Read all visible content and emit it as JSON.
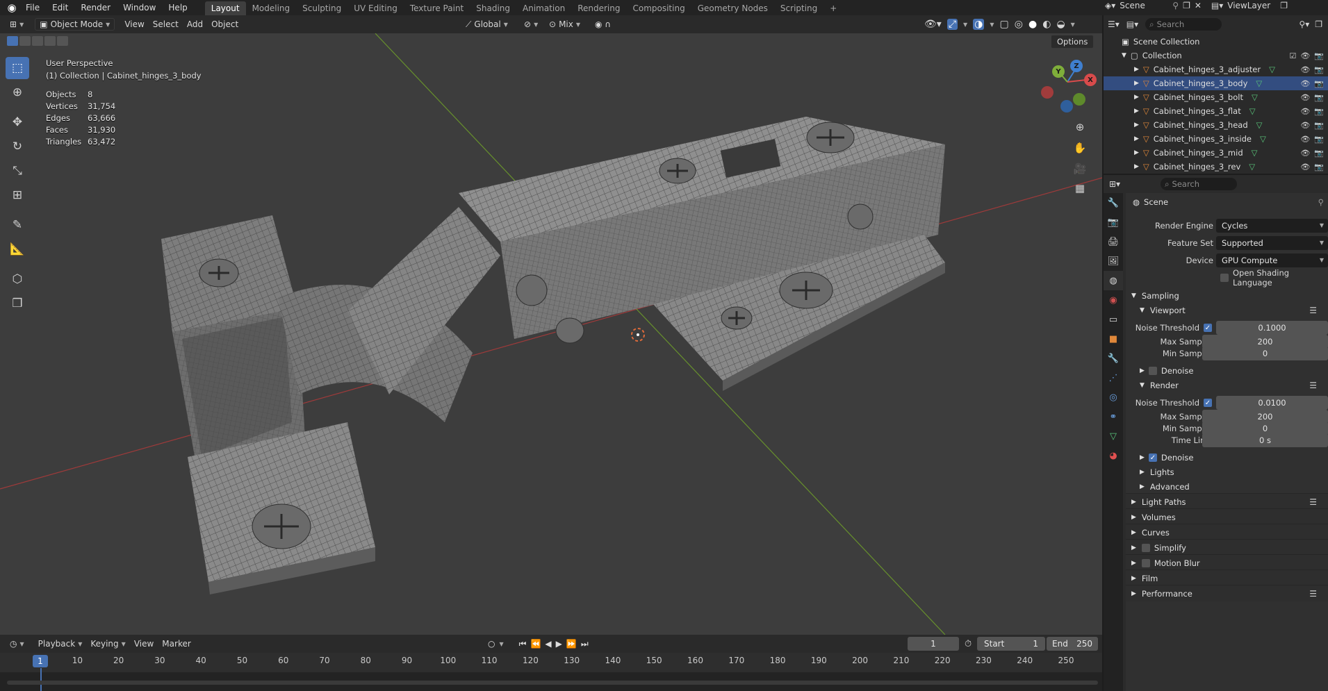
{
  "menu": [
    "File",
    "Edit",
    "Render",
    "Window",
    "Help"
  ],
  "workspaces": [
    "Layout",
    "Modeling",
    "Sculpting",
    "UV Editing",
    "Texture Paint",
    "Shading",
    "Animation",
    "Rendering",
    "Compositing",
    "Geometry Nodes",
    "Scripting"
  ],
  "scene": {
    "label": "Scene",
    "view_layer": "ViewLayer"
  },
  "viewport_header": {
    "mode": "Object Mode",
    "menus": [
      "View",
      "Select",
      "Add",
      "Object"
    ],
    "orientation": "Global",
    "proportional": "Mix",
    "options": "Options"
  },
  "overlay": {
    "perspective": "User Perspective",
    "context": "(1) Collection | Cabinet_hinges_3_body",
    "stats": [
      {
        "k": "Objects",
        "v": "8"
      },
      {
        "k": "Vertices",
        "v": "31,754"
      },
      {
        "k": "Edges",
        "v": "63,666"
      },
      {
        "k": "Faces",
        "v": "31,930"
      },
      {
        "k": "Triangles",
        "v": "63,472"
      }
    ]
  },
  "gizmo": {
    "x": "X",
    "y": "Y",
    "z": "Z"
  },
  "timeline": {
    "menus": [
      "Playback",
      "Keying",
      "View",
      "Marker"
    ],
    "current": "1",
    "start_label": "Start",
    "start": "1",
    "end_label": "End",
    "end": "250",
    "ticks": [
      "1",
      "10",
      "20",
      "30",
      "40",
      "50",
      "60",
      "70",
      "80",
      "90",
      "100",
      "110",
      "120",
      "130",
      "140",
      "150",
      "160",
      "170",
      "180",
      "190",
      "200",
      "210",
      "220",
      "230",
      "240",
      "250"
    ]
  },
  "outliner": {
    "search": "Search",
    "root": "Scene Collection",
    "collection": "Collection",
    "items": [
      "Cabinet_hinges_3_adjuster",
      "Cabinet_hinges_3_body",
      "Cabinet_hinges_3_bolt",
      "Cabinet_hinges_3_flat",
      "Cabinet_hinges_3_head",
      "Cabinet_hinges_3_inside",
      "Cabinet_hinges_3_mid",
      "Cabinet_hinges_3_rev"
    ],
    "selected_index": 1
  },
  "properties": {
    "search": "Search",
    "context": "Scene",
    "render_engine": {
      "label": "Render Engine",
      "value": "Cycles"
    },
    "feature_set": {
      "label": "Feature Set",
      "value": "Supported"
    },
    "device": {
      "label": "Device",
      "value": "GPU Compute"
    },
    "osl": "Open Shading Language",
    "sampling": "Sampling",
    "viewport": {
      "title": "Viewport",
      "noise_label": "Noise Threshold",
      "noise": "0.1000",
      "max_label": "Max Samples",
      "max": "200",
      "min_label": "Min Samples",
      "min": "0",
      "denoise": "Denoise"
    },
    "render": {
      "title": "Render",
      "noise_label": "Noise Threshold",
      "noise": "0.0100",
      "max_label": "Max Samples",
      "max": "200",
      "min_label": "Min Samples",
      "min": "0",
      "time_label": "Time Limit",
      "time": "0 s",
      "denoise": "Denoise"
    },
    "subs": [
      "Lights",
      "Advanced"
    ],
    "sections": [
      "Light Paths",
      "Volumes",
      "Curves",
      "Simplify",
      "Motion Blur",
      "Film",
      "Performance"
    ]
  },
  "colors": {
    "accent": "#4772b3",
    "grid_x": "#b03a3a",
    "grid_y": "#6c9a2b"
  }
}
